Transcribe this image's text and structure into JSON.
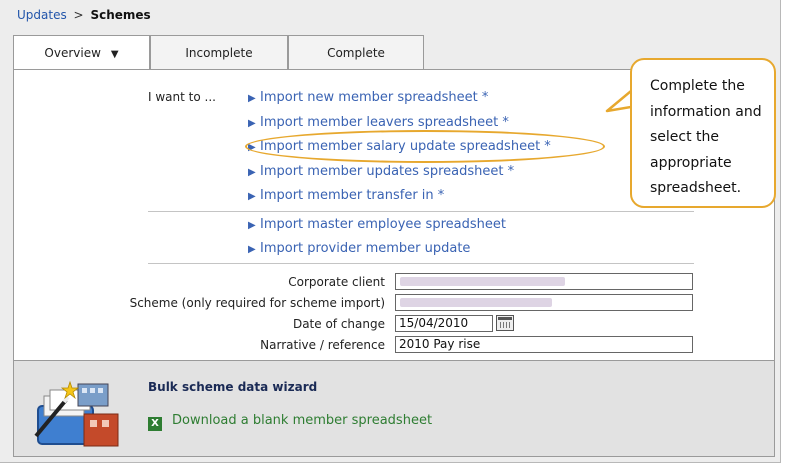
{
  "breadcrumb": {
    "parent": "Updates",
    "separator": ">",
    "current": "Schemes"
  },
  "tabs": [
    {
      "label": "Overview",
      "active": true
    },
    {
      "label": "Incomplete",
      "active": false
    },
    {
      "label": "Complete",
      "active": false
    }
  ],
  "intro_label": "I want to ...",
  "scheme_actions": [
    "Import new member spreadsheet *",
    "Import member leavers spreadsheet *",
    "Import member salary update spreadsheet *",
    "Import member updates spreadsheet *",
    "Import member transfer in *"
  ],
  "other_actions": [
    "Import master employee spreadsheet",
    "Import provider member update"
  ],
  "form": {
    "corporate_client_label": "Corporate client",
    "scheme_label": "Scheme (only required for scheme import)",
    "date_label": "Date of change",
    "date_value": "15/04/2010",
    "narrative_label": "Narrative / reference",
    "narrative_value": "2010 Pay rise"
  },
  "wizard": {
    "title": "Bulk scheme data wizard",
    "download_link": "Download a blank member spreadsheet"
  },
  "callout_text": "Complete the information and select the appropriate spreadsheet.",
  "colors": {
    "link": "#3a63b3",
    "highlight": "#e7a82e",
    "download": "#2e7d32"
  }
}
